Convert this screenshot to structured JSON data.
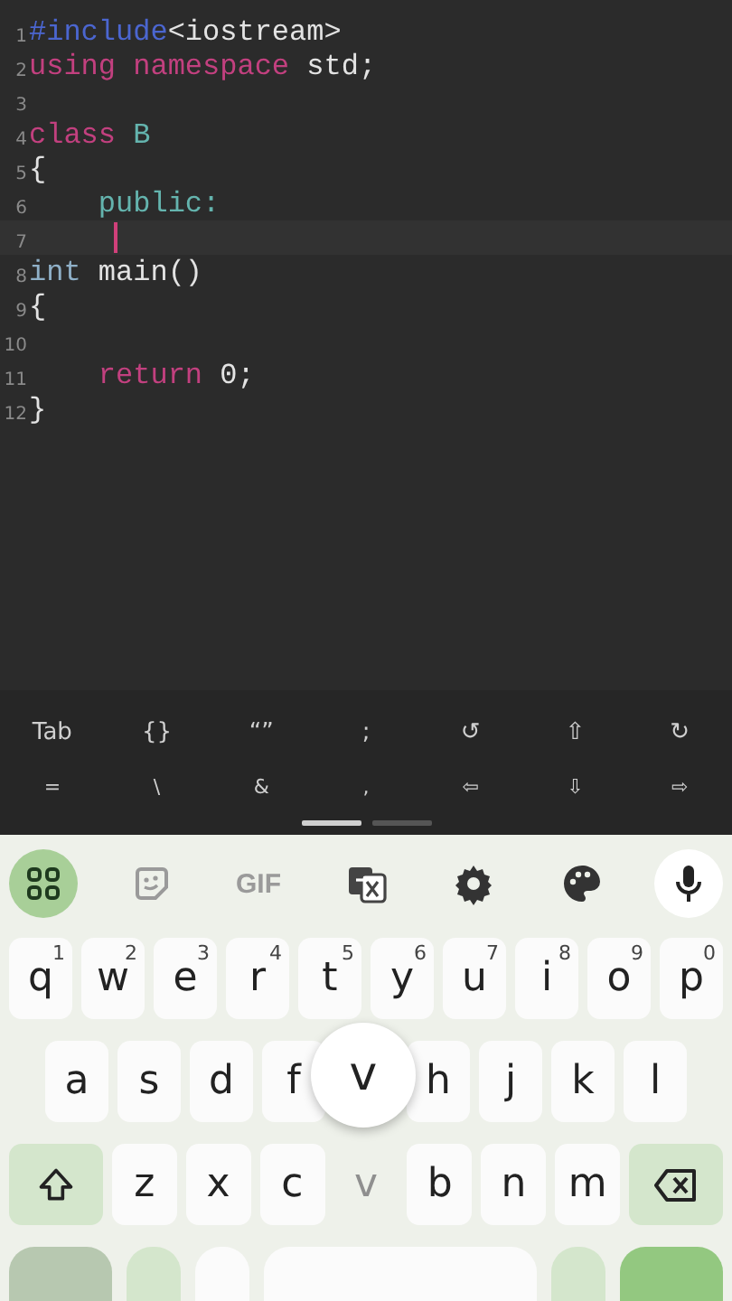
{
  "editor": {
    "lines": [
      {
        "number": "1",
        "tokens": [
          {
            "text": "#include",
            "kind": "directive"
          },
          {
            "text": "<iostream>",
            "kind": "plain"
          }
        ]
      },
      {
        "number": "2",
        "tokens": [
          {
            "text": "using namespace",
            "kind": "keyword"
          },
          {
            "text": " std;",
            "kind": "plain"
          }
        ]
      },
      {
        "number": "3"
      },
      {
        "number": "4",
        "tokens": [
          {
            "text": "class",
            "kind": "keyword"
          },
          {
            "text": " B",
            "kind": "name"
          }
        ]
      },
      {
        "number": "5",
        "tokens": [
          {
            "text": "{",
            "kind": "plain"
          }
        ]
      },
      {
        "number": "6",
        "tokens": [
          {
            "text": "    public:",
            "kind": "name"
          }
        ]
      },
      {
        "number": "7",
        "current": true
      },
      {
        "number": "8",
        "tokens": [
          {
            "text": "int",
            "kind": "type"
          },
          {
            "text": " main()",
            "kind": "plain"
          }
        ]
      },
      {
        "number": "9",
        "tokens": [
          {
            "text": "{",
            "kind": "plain"
          }
        ]
      },
      {
        "number": "10"
      },
      {
        "number": "11",
        "tokens": [
          {
            "text": "    return",
            "kind": "keyword"
          },
          {
            "text": " 0;",
            "kind": "plain"
          }
        ]
      },
      {
        "number": "12",
        "tokens": [
          {
            "text": "}",
            "kind": "plain"
          }
        ]
      }
    ]
  },
  "extra_keys": {
    "rows": [
      [
        "Tab",
        "{}",
        "“”",
        ";",
        "↺",
        "⇧",
        "↻"
      ],
      [
        "=",
        "\\",
        "&",
        ",",
        "⇦",
        "⇩",
        "⇨"
      ]
    ],
    "pages": [
      {
        "selected": true
      },
      {
        "selected": false
      }
    ]
  },
  "keyboard": {
    "toolbar": [
      {
        "kind": "grid",
        "selected": true
      },
      {
        "kind": "sticker",
        "selected": false
      },
      {
        "kind": "gif",
        "label": "GIF",
        "selected": false
      },
      {
        "kind": "translate",
        "selected": false
      },
      {
        "kind": "settings",
        "selected": false
      },
      {
        "kind": "palette",
        "selected": false
      },
      {
        "kind": "mic",
        "selected": false
      }
    ],
    "rows": [
      [
        {
          "label": "q",
          "hint": "1"
        },
        {
          "label": "w",
          "hint": "2"
        },
        {
          "label": "e",
          "hint": "3"
        },
        {
          "label": "r",
          "hint": "4"
        },
        {
          "label": "t",
          "hint": "5"
        },
        {
          "label": "y",
          "hint": "6"
        },
        {
          "label": "u",
          "hint": "7"
        },
        {
          "label": "i",
          "hint": "8"
        },
        {
          "label": "o",
          "hint": "9"
        },
        {
          "label": "p",
          "hint": "0"
        }
      ],
      [
        {
          "label": "a"
        },
        {
          "label": "s"
        },
        {
          "label": "d"
        },
        {
          "label": "f"
        },
        {
          "kind": "hidden"
        },
        {
          "label": "h"
        },
        {
          "label": "j"
        },
        {
          "label": "k"
        },
        {
          "label": "l"
        }
      ],
      [
        {
          "kind": "shift"
        },
        {
          "label": "z"
        },
        {
          "label": "x"
        },
        {
          "label": "c"
        },
        {
          "label": "v",
          "pressed": true
        },
        {
          "label": "b"
        },
        {
          "label": "n"
        },
        {
          "label": "m"
        },
        {
          "kind": "backspace"
        }
      ]
    ],
    "preview": {
      "label": "v"
    }
  }
}
